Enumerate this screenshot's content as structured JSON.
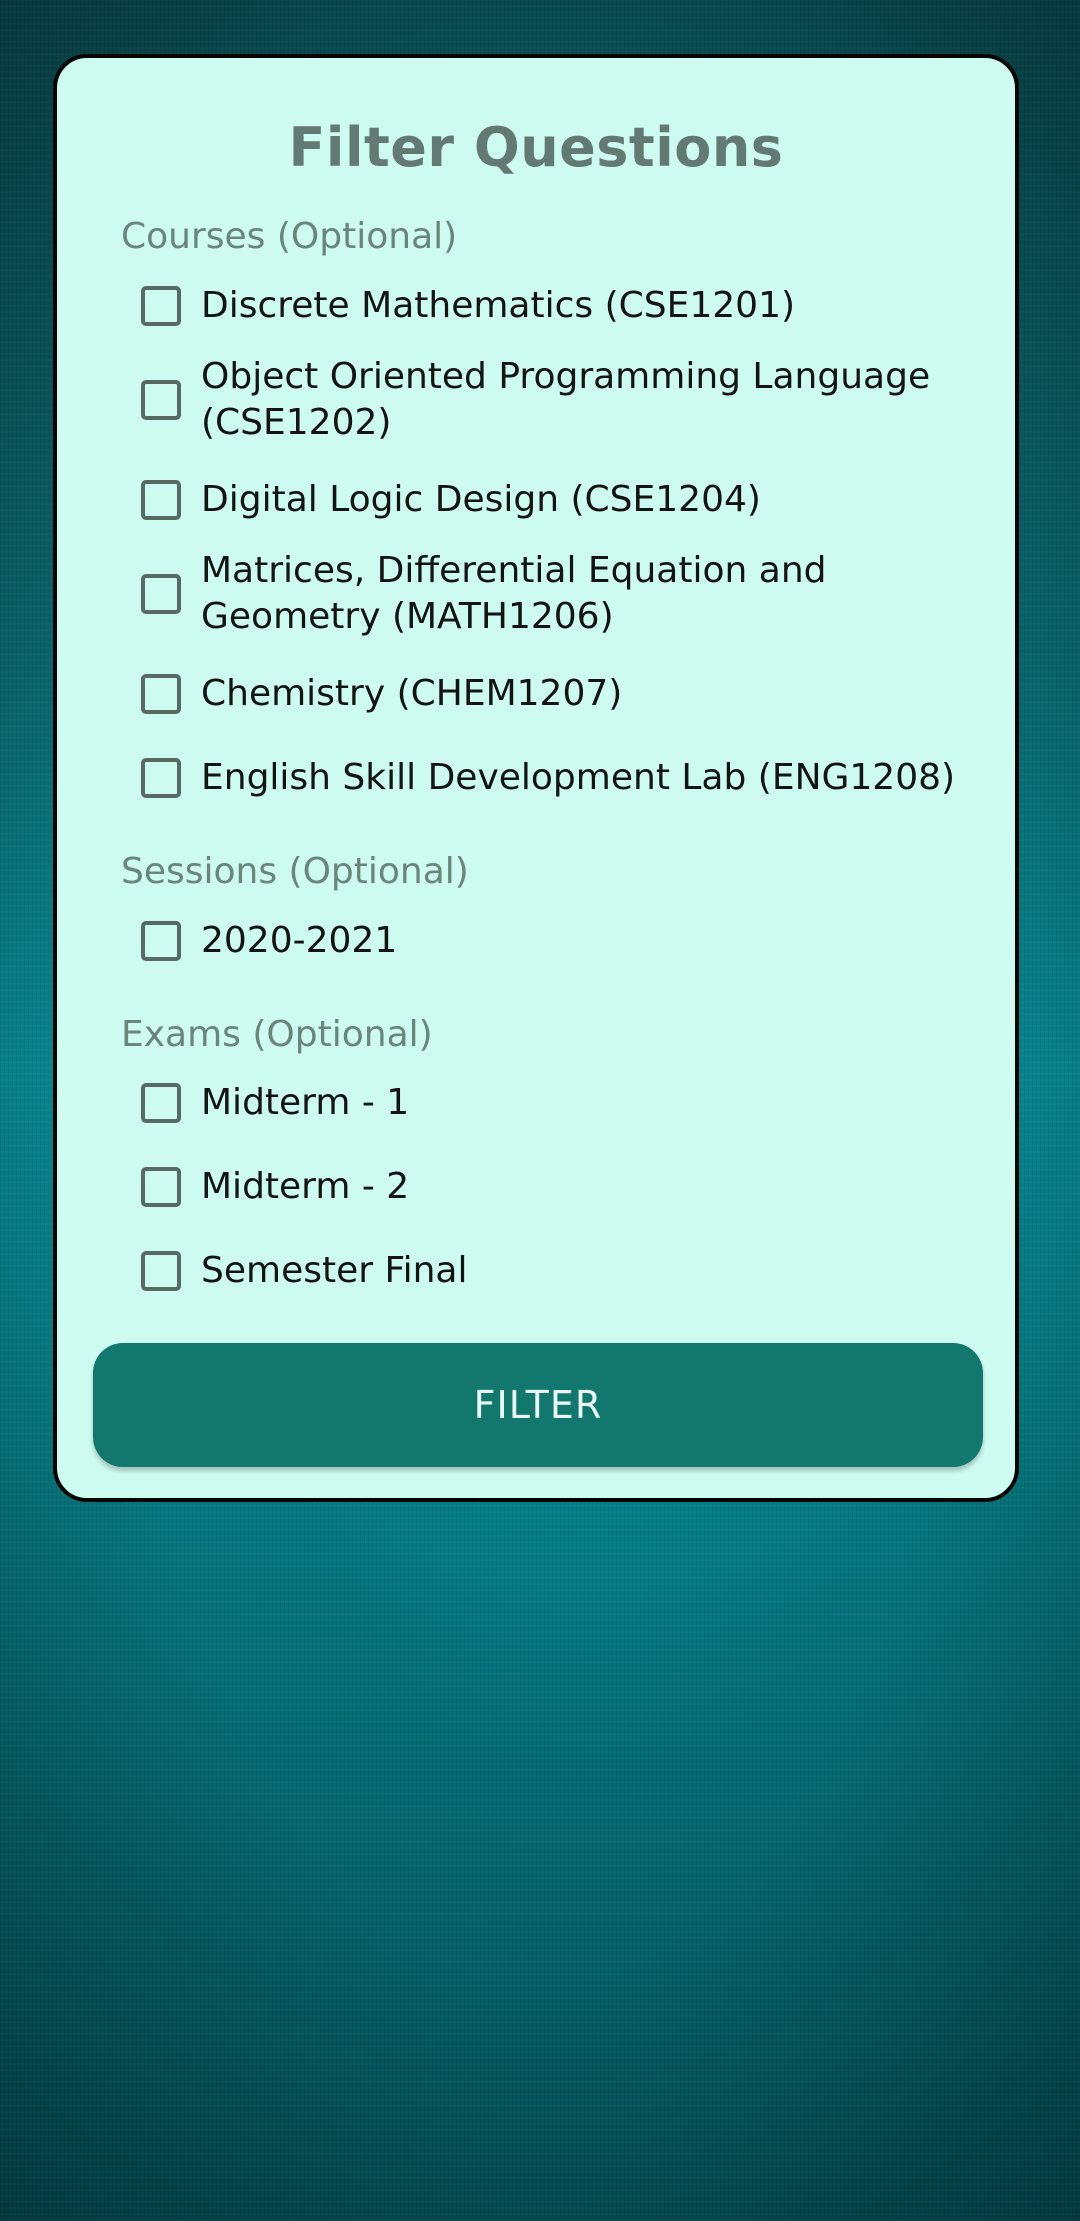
{
  "title": "Filter Questions",
  "sections": {
    "courses": {
      "label": "Courses (Optional)",
      "options": [
        "Discrete Mathematics (CSE1201)",
        "Object Oriented Programming Language (CSE1202)",
        "Digital Logic Design (CSE1204)",
        "Matrices, Differential Equation and Geometry (MATH1206)",
        "Chemistry (CHEM1207)",
        "English Skill Development Lab (ENG1208)"
      ]
    },
    "sessions": {
      "label": "Sessions (Optional)",
      "options": [
        "2020-2021"
      ]
    },
    "exams": {
      "label": "Exams (Optional)",
      "options": [
        "Midterm - 1",
        "Midterm - 2",
        "Semester Final"
      ]
    }
  },
  "filter_button": "FILTER",
  "colors": {
    "card_background": "#cdfbef",
    "button": "#12776d",
    "title": "#637a72"
  }
}
